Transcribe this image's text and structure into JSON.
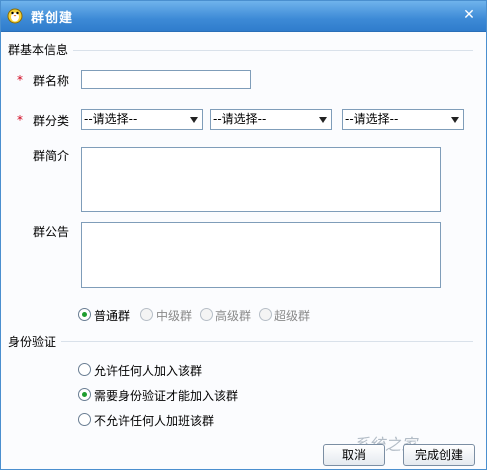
{
  "window": {
    "title": "群创建",
    "close_label": "✕"
  },
  "basic_info": {
    "section_title": "群基本信息",
    "name_label": "群名称",
    "name_value": "",
    "category_label": "群分类",
    "category_selects": [
      "--请选择--",
      "--请选择--",
      "--请选择--"
    ],
    "intro_label": "群简介",
    "intro_value": "",
    "notice_label": "群公告",
    "notice_value": "",
    "required_mark": "*",
    "group_types": [
      {
        "label": "普通群",
        "checked": true,
        "disabled": false
      },
      {
        "label": "中级群",
        "checked": false,
        "disabled": true
      },
      {
        "label": "高级群",
        "checked": false,
        "disabled": true
      },
      {
        "label": "超级群",
        "checked": false,
        "disabled": true
      }
    ]
  },
  "verification": {
    "section_title": "身份验证",
    "options": [
      {
        "label": "允许任何人加入该群",
        "checked": false
      },
      {
        "label": "需要身份验证才能加入该群",
        "checked": true
      },
      {
        "label": "不允许任何人加班该群",
        "checked": false
      }
    ]
  },
  "buttons": {
    "cancel_label": "取消",
    "create_label": "完成创建"
  },
  "watermark": {
    "text": "系统之家"
  },
  "colors": {
    "titlebar": "#3d8ad6",
    "required": "#d0001a",
    "radio_check": "#1f9d2f"
  }
}
